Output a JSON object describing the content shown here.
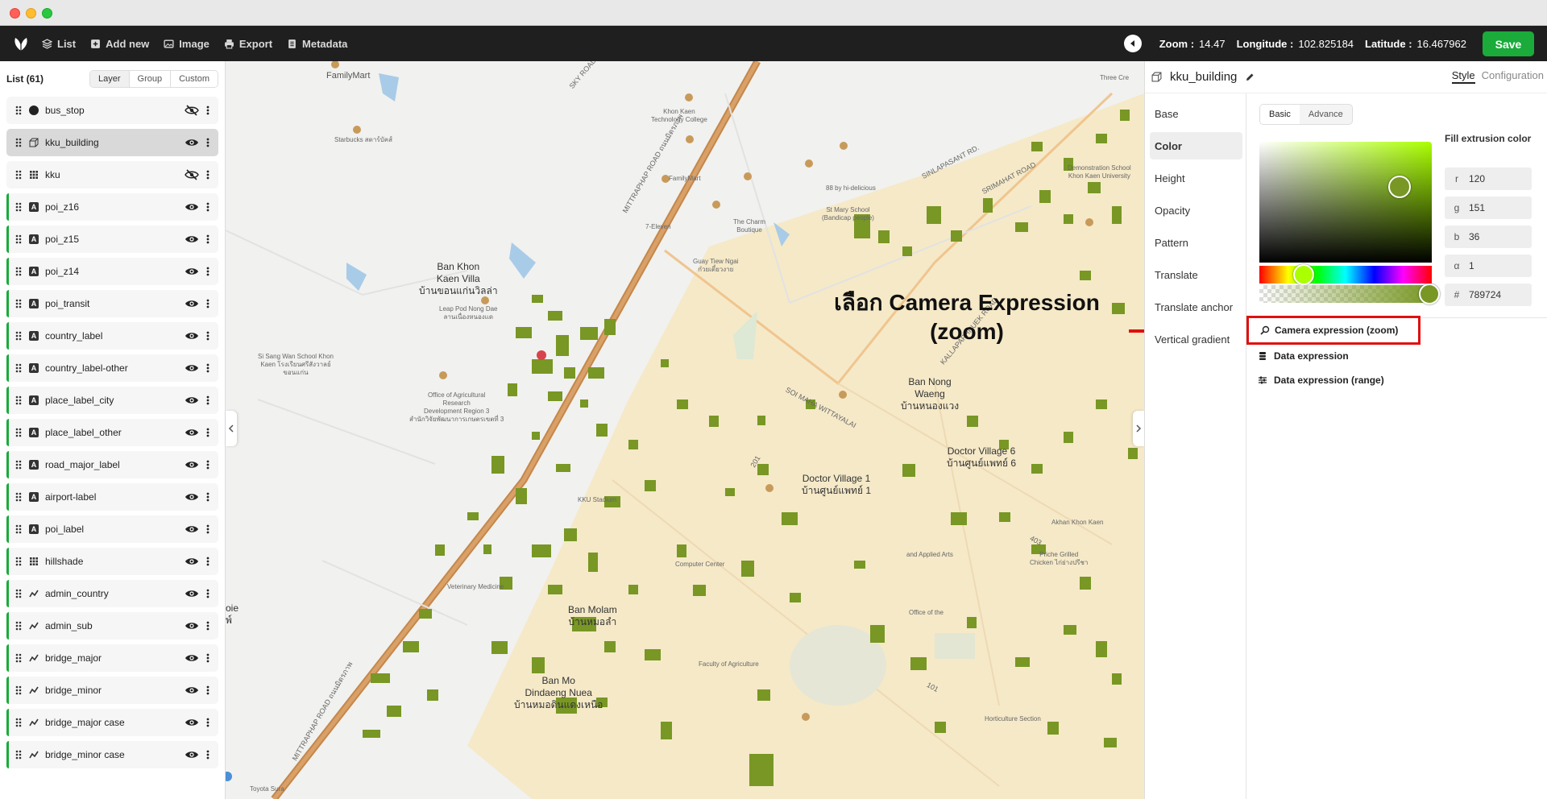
{
  "window": {
    "controls": [
      "close",
      "minimize",
      "maximize"
    ]
  },
  "toolbar": {
    "items": [
      {
        "label": "List",
        "icon": "layers-icon"
      },
      {
        "label": "Add new",
        "icon": "add-square-icon"
      },
      {
        "label": "Image",
        "icon": "image-icon"
      },
      {
        "label": "Export",
        "icon": "printer-icon"
      },
      {
        "label": "Metadata",
        "icon": "list-icon"
      }
    ],
    "zoom_label": "Zoom :",
    "zoom_value": "14.47",
    "longitude_label": "Longitude :",
    "longitude_value": "102.825184",
    "latitude_label": "Latitude :",
    "latitude_value": "16.467962",
    "save_label": "Save",
    "accent": "#1aab3a"
  },
  "layer_panel": {
    "title": "List (61)",
    "tabs": [
      "Layer",
      "Group",
      "Custom"
    ],
    "active_tab": "Layer",
    "layers": [
      {
        "name": "bus_stop",
        "type": "circle",
        "visible": false,
        "selected": false,
        "green": false
      },
      {
        "name": "kku_building",
        "type": "fill-extrusion",
        "visible": true,
        "selected": true,
        "green": false
      },
      {
        "name": "kku",
        "type": "raster",
        "visible": false,
        "selected": false,
        "green": false
      },
      {
        "name": "poi_z16",
        "type": "symbol",
        "visible": true,
        "selected": false,
        "green": true
      },
      {
        "name": "poi_z15",
        "type": "symbol",
        "visible": true,
        "selected": false,
        "green": true
      },
      {
        "name": "poi_z14",
        "type": "symbol",
        "visible": true,
        "selected": false,
        "green": true
      },
      {
        "name": "poi_transit",
        "type": "symbol",
        "visible": true,
        "selected": false,
        "green": true
      },
      {
        "name": "country_label",
        "type": "symbol",
        "visible": true,
        "selected": false,
        "green": true
      },
      {
        "name": "country_label-other",
        "type": "symbol",
        "visible": true,
        "selected": false,
        "green": true
      },
      {
        "name": "place_label_city",
        "type": "symbol",
        "visible": true,
        "selected": false,
        "green": true
      },
      {
        "name": "place_label_other",
        "type": "symbol",
        "visible": true,
        "selected": false,
        "green": true
      },
      {
        "name": "road_major_label",
        "type": "symbol",
        "visible": true,
        "selected": false,
        "green": true
      },
      {
        "name": "airport-label",
        "type": "symbol",
        "visible": true,
        "selected": false,
        "green": true
      },
      {
        "name": "poi_label",
        "type": "symbol",
        "visible": true,
        "selected": false,
        "green": true
      },
      {
        "name": "hillshade",
        "type": "raster",
        "visible": true,
        "selected": false,
        "green": true
      },
      {
        "name": "admin_country",
        "type": "line",
        "visible": true,
        "selected": false,
        "green": true
      },
      {
        "name": "admin_sub",
        "type": "line",
        "visible": true,
        "selected": false,
        "green": true
      },
      {
        "name": "bridge_major",
        "type": "line",
        "visible": true,
        "selected": false,
        "green": true
      },
      {
        "name": "bridge_minor",
        "type": "line",
        "visible": true,
        "selected": false,
        "green": true
      },
      {
        "name": "bridge_major case",
        "type": "line",
        "visible": true,
        "selected": false,
        "green": true
      },
      {
        "name": "bridge_minor case",
        "type": "line",
        "visible": true,
        "selected": false,
        "green": true
      }
    ]
  },
  "map": {
    "labels": [
      {
        "id": "familymart-1",
        "text": "FamilyMart"
      },
      {
        "id": "starbucks",
        "text": "Starbucks สตาร์บัคส์"
      },
      {
        "id": "ban-khon-kaen-villa",
        "text": "Ban Khon\nKaen Villa\nบ้านขอนแก่นวิลล่า"
      },
      {
        "id": "leap-pod",
        "text": "Leap Pod Nong Dae\nลานเนื่องหนองแด"
      },
      {
        "id": "si-sang-wan",
        "text": "Si Sang Wan School Khon\nKaen โรงเรียนศรีสังวาลย์\nขอนแก่น"
      },
      {
        "id": "office-agri",
        "text": "Office of Agricultural\nResearch\nDevelopment Region 3\nสำนักวิจัยพัฒนาการเกษตรเขตที่ 3"
      },
      {
        "id": "khon-kaen-tech",
        "text": "Khon Kaen\nTechnology College"
      },
      {
        "id": "familymart-2",
        "text": "FamilyMart"
      },
      {
        "id": "seven-eleven",
        "text": "7-Eleven"
      },
      {
        "id": "guay-tiew",
        "text": "Guay Tiew Ngai\nก๋วยเตี๋ยวงาย"
      },
      {
        "id": "charm-boutique",
        "text": "The Charm\nBoutique"
      },
      {
        "id": "st-mary",
        "text": "St Mary School\n(Bandicap people)"
      },
      {
        "id": "88-hi",
        "text": "88 by hi-delicious"
      },
      {
        "id": "demo-school",
        "text": "Demonstration School\nKhon Kaen University"
      },
      {
        "id": "ban-nong-waeng",
        "text": "Ban Nong\nWaeng\nบ้านหนองแวง"
      },
      {
        "id": "doctor-village-6",
        "text": "Doctor Village 6\nบ้านศูนย์แพทย์ 6"
      },
      {
        "id": "doctor-village-1",
        "text": "Doctor Village 1\nบ้านศูนย์แพทย์ 1"
      },
      {
        "id": "ban-molam",
        "text": "Ban Molam\nบ้านหมอลำ"
      },
      {
        "id": "ban-mo-dindaeng",
        "text": "Ban Mo\nDindaeng Nuea\nบ้านหมอดินแดงเหนือ"
      },
      {
        "id": "kku-stadium",
        "text": "KKU Stadium"
      },
      {
        "id": "computer-center",
        "text": "Computer Center"
      },
      {
        "id": "faculty-agri",
        "text": "Faculty of Agriculture"
      },
      {
        "id": "vet-medicine",
        "text": "Veterinary Medicine"
      },
      {
        "id": "applied-arts",
        "text": "and Applied Arts"
      },
      {
        "id": "office-of-the",
        "text": "Office of the"
      },
      {
        "id": "akhan",
        "text": "Akhan Khon Kaen"
      },
      {
        "id": "priche-grilled",
        "text": "Priche Grilled\nChicken ไก่ย่างปรีชา"
      },
      {
        "id": "horticulture",
        "text": "Horticulture Section"
      },
      {
        "id": "toyota",
        "text": "Toyota Sura"
      },
      {
        "id": "mittraphap-1",
        "text": "MITTRAPHAP ROAD ถนนมิตรภาพ"
      },
      {
        "id": "mittraphap-2",
        "text": "MITTRAPHAP ROAD ถนนมิตรภาพ"
      },
      {
        "id": "soi-maha",
        "text": "SOI MAHA WITTAYALAI"
      },
      {
        "id": "kallaprapruek",
        "text": "KALLAPAPHRUEK ROAD"
      },
      {
        "id": "sinlapasarnt",
        "text": "SINLAPASANT RD."
      },
      {
        "id": "srimahat",
        "text": "SRIMAHAT ROAD"
      },
      {
        "id": "three-cre",
        "text": "Three Cre"
      },
      {
        "id": "sky-road",
        "text": "SKY ROAD"
      },
      {
        "id": "road-201",
        "text": "201"
      },
      {
        "id": "road-403",
        "text": "403"
      },
      {
        "id": "road-101",
        "text": "101"
      },
      {
        "id": "bl-partial",
        "text": "oie\nพ์"
      }
    ],
    "building_color": "#789724"
  },
  "annotation": {
    "line1": "เลือก Camera Expression",
    "line2": "(zoom)",
    "color": "#e01010"
  },
  "style_panel": {
    "layer_name": "kku_building",
    "tabs": {
      "style": "Style",
      "config": "Configuration"
    },
    "properties": [
      "Base",
      "Color",
      "Height",
      "Opacity",
      "Pattern",
      "Translate",
      "Translate anchor",
      "Vertical gradient"
    ],
    "active_property": "Color",
    "sub_tabs": [
      "Basic",
      "Advance"
    ],
    "active_sub_tab": "Basic",
    "fill_label": "Fill extrusion color",
    "channels": {
      "r": {
        "label": "r",
        "value": "120"
      },
      "g": {
        "label": "g",
        "value": "151"
      },
      "b": {
        "label": "b",
        "value": "36"
      },
      "a": {
        "label": "α",
        "value": "1"
      },
      "hex": {
        "label": "#",
        "value": "789724"
      }
    },
    "expressions": {
      "camera": "Camera expression (zoom)",
      "data": "Data expression",
      "range": "Data expression (range)"
    }
  }
}
